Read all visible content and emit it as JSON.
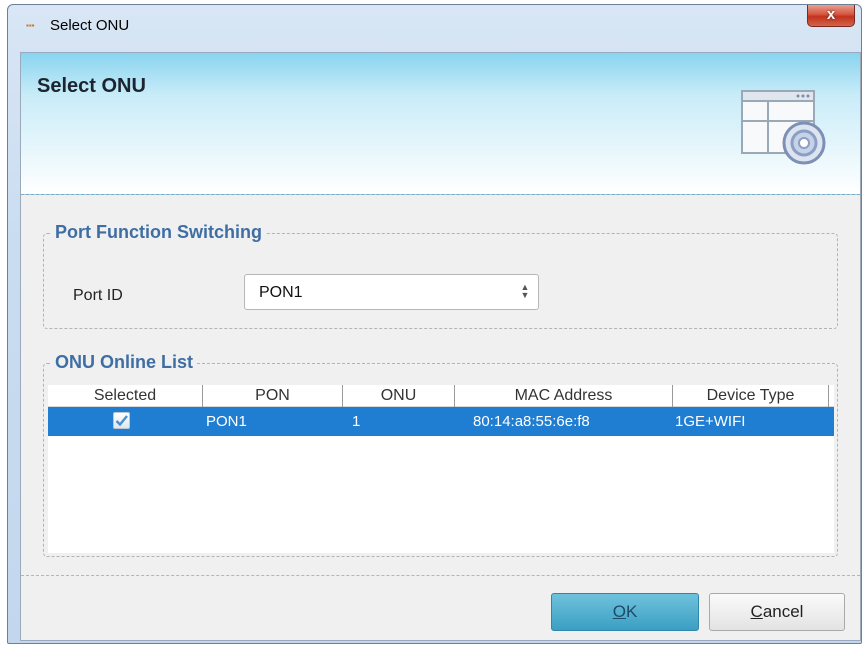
{
  "window": {
    "title": "Select ONU",
    "icon": "app-icon",
    "close_label": "x"
  },
  "banner": {
    "title": "Select ONU",
    "icon": "window-settings-icon"
  },
  "port_group": {
    "title": "Port Function Switching",
    "port_id_label": "Port ID",
    "port_id_value": "PON1"
  },
  "onu_group": {
    "title": "ONU Online List",
    "columns": [
      "Selected",
      "PON",
      "ONU",
      "MAC Address",
      "Device Type"
    ],
    "rows": [
      {
        "selected": true,
        "pon": "PON1",
        "onu": "1",
        "mac": "80:14:a8:55:6e:f8",
        "device_type": "1GE+WIFI"
      }
    ]
  },
  "buttons": {
    "ok": "OK",
    "cancel": "Cancel"
  },
  "colors": {
    "selection": "#1f7ed1",
    "group_title": "#3e6ea3",
    "ok_button": "#3b9fc3"
  }
}
